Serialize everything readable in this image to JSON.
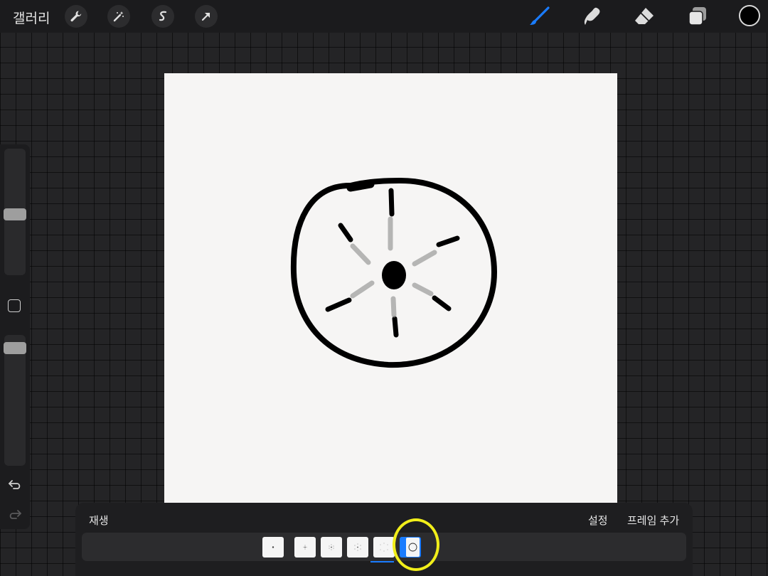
{
  "topbar": {
    "gallery_label": "갤러리",
    "left_tools": [
      "wrench-icon",
      "magic-wand-icon",
      "selection-s-icon",
      "transform-arrow-icon"
    ],
    "right_tools": [
      "brush-icon",
      "smudge-icon",
      "eraser-icon",
      "layers-icon"
    ],
    "active_tool": "brush-icon",
    "current_color": "#000000",
    "accent_color": "#1a7cff"
  },
  "sidebar": {
    "brush_size": 0.48,
    "opacity": 0.06
  },
  "animation": {
    "play_label": "재생",
    "settings_label": "설정",
    "add_frame_label": "프레임 추가",
    "frames": [
      {
        "name": "frame-1"
      },
      {
        "name": "frame-2"
      },
      {
        "name": "frame-3"
      },
      {
        "name": "frame-4"
      },
      {
        "name": "frame-5"
      },
      {
        "name": "frame-6",
        "selected": true
      }
    ]
  }
}
